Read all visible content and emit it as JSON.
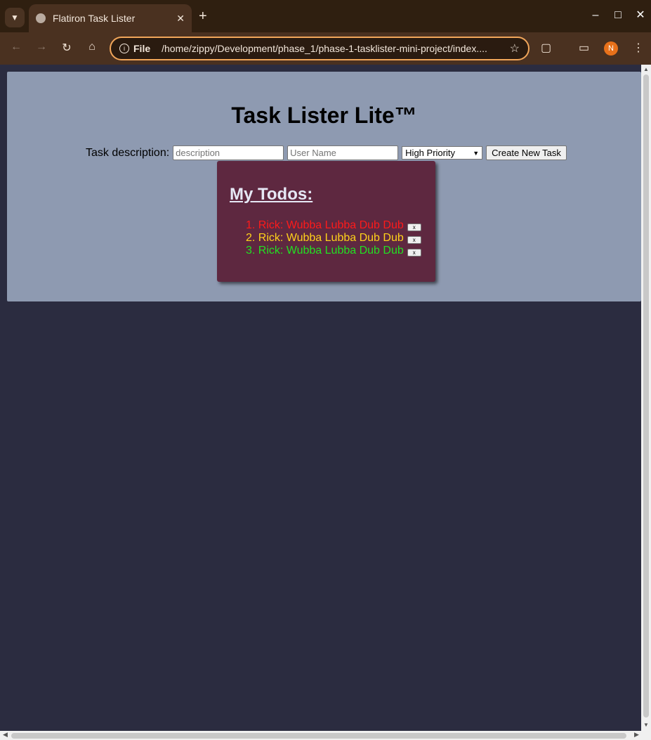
{
  "browser": {
    "tab_title": "Flatiron Task Lister",
    "tab_close": "✕",
    "new_tab": "+",
    "url_scheme": "File",
    "url": "/home/zippy/Development/phase_1/phase-1-tasklister-mini-project/index....",
    "profile_initial": "N",
    "icons": [
      "chevron-down-icon",
      "globe-icon",
      "back-icon",
      "forward-icon",
      "reload-icon",
      "home-icon",
      "info-icon",
      "star-icon",
      "extensions-icon",
      "cast-icon",
      "menu-icon"
    ],
    "accent": "#f1a65a"
  },
  "page": {
    "title": "Task Lister Lite™",
    "form": {
      "label": "Task description:",
      "description_placeholder": "description",
      "username_placeholder": "User Name",
      "priority_selected": "High Priority",
      "submit_label": "Create New Task"
    },
    "todos": {
      "heading": "My Todos:",
      "delete_label": "x",
      "items": [
        {
          "number": "1.",
          "text": "Rick: Wubba Lubba Dub Dub",
          "color": "#ff1a1a"
        },
        {
          "number": "2.",
          "text": "Rick: Wubba Lubba Dub Dub",
          "color": "#ffd21a"
        },
        {
          "number": "3.",
          "text": "Rick: Wubba Lubba Dub Dub",
          "color": "#22e022"
        }
      ]
    }
  }
}
